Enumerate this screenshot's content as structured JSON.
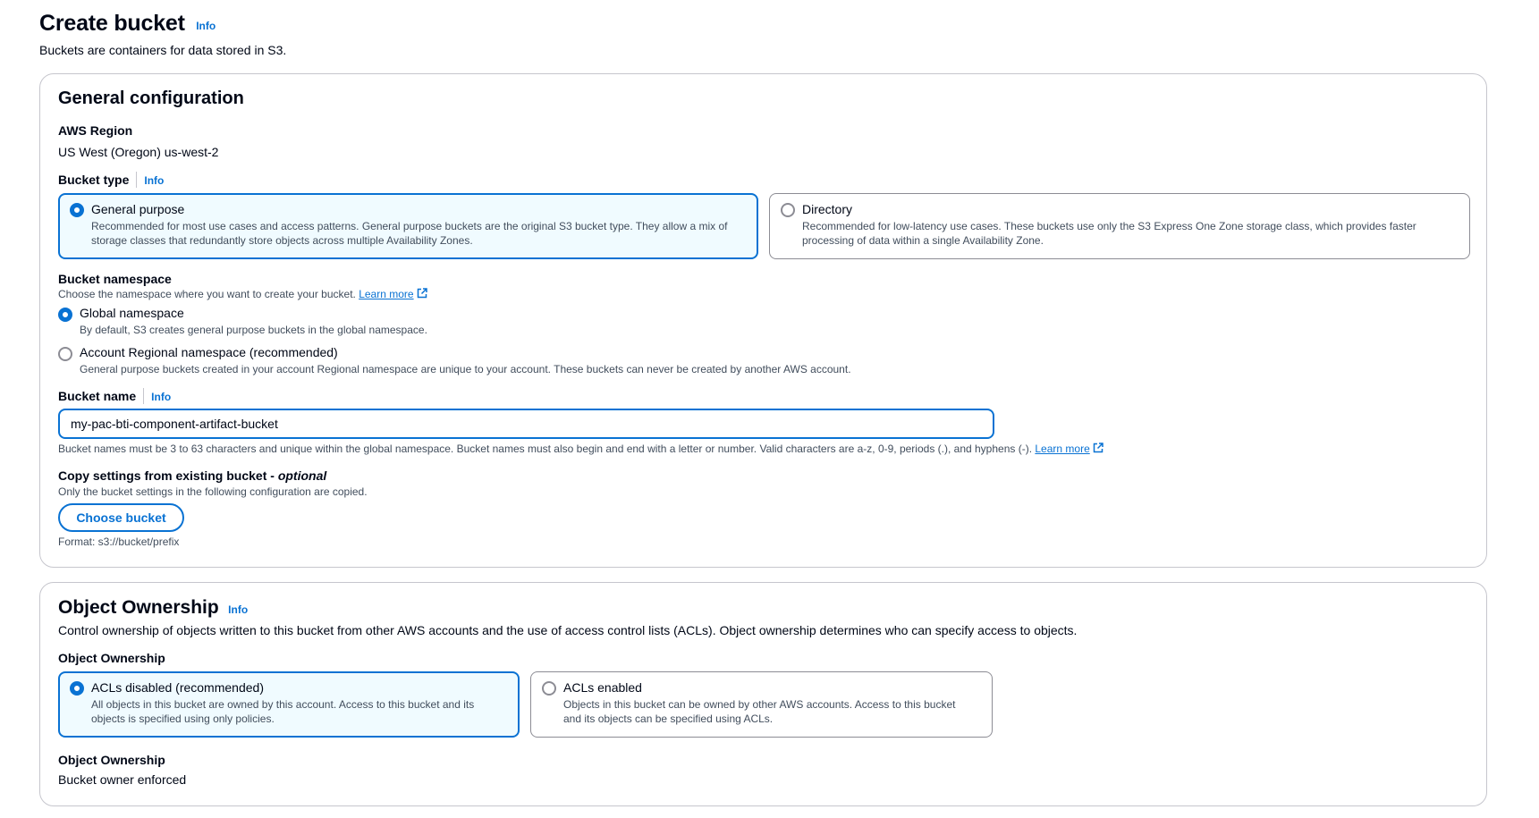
{
  "header": {
    "title": "Create bucket",
    "info": "Info",
    "description": "Buckets are containers for data stored in S3."
  },
  "general": {
    "title": "General configuration",
    "region_label": "AWS Region",
    "region_value": "US West (Oregon) us-west-2",
    "bucket_type": {
      "label": "Bucket type",
      "info": "Info",
      "options": [
        {
          "label": "General purpose",
          "description": "Recommended for most use cases and access patterns. General purpose buckets are the original S3 bucket type. They allow a mix of storage classes that redundantly store objects across multiple Availability Zones.",
          "selected": true
        },
        {
          "label": "Directory",
          "description": "Recommended for low-latency use cases. These buckets use only the S3 Express One Zone storage class, which provides faster processing of data within a single Availability Zone.",
          "selected": false
        }
      ]
    },
    "namespace": {
      "label": "Bucket namespace",
      "description": "Choose the namespace where you want to create your bucket.",
      "learn_more": "Learn more",
      "options": [
        {
          "label": "Global namespace",
          "description": "By default, S3 creates general purpose buckets in the global namespace.",
          "selected": true
        },
        {
          "label": "Account Regional namespace (recommended)",
          "description": "General purpose buckets created in your account Regional namespace are unique to your account. These buckets can never be created by another AWS account.",
          "selected": false
        }
      ]
    },
    "bucket_name": {
      "label": "Bucket name",
      "info": "Info",
      "value": "my-pac-bti-component-artifact-bucket",
      "constraint": "Bucket names must be 3 to 63 characters and unique within the global namespace. Bucket names must also begin and end with a letter or number. Valid characters are a-z, 0-9, periods (.), and hyphens (-).",
      "learn_more": "Learn more"
    },
    "copy_settings": {
      "label": "Copy settings from existing bucket - ",
      "label_optional": "optional",
      "description": "Only the bucket settings in the following configuration are copied.",
      "button": "Choose bucket",
      "format": "Format: s3://bucket/prefix"
    }
  },
  "ownership": {
    "title": "Object Ownership",
    "info": "Info",
    "description": "Control ownership of objects written to this bucket from other AWS accounts and the use of access control lists (ACLs). Object ownership determines who can specify access to objects.",
    "field_label": "Object Ownership",
    "options": [
      {
        "label": "ACLs disabled (recommended)",
        "description": "All objects in this bucket are owned by this account. Access to this bucket and its objects is specified using only policies.",
        "selected": true
      },
      {
        "label": "ACLs enabled",
        "description": "Objects in this bucket can be owned by other AWS accounts. Access to this bucket and its objects can be specified using ACLs.",
        "selected": false
      }
    ],
    "result_label": "Object Ownership",
    "result_value": "Bucket owner enforced"
  },
  "colors": {
    "accent": "#0972d3",
    "selected_bg": "#f0fbff",
    "border": "#c6c6cd",
    "text": "#000716",
    "secondary_text": "#414d5c"
  }
}
